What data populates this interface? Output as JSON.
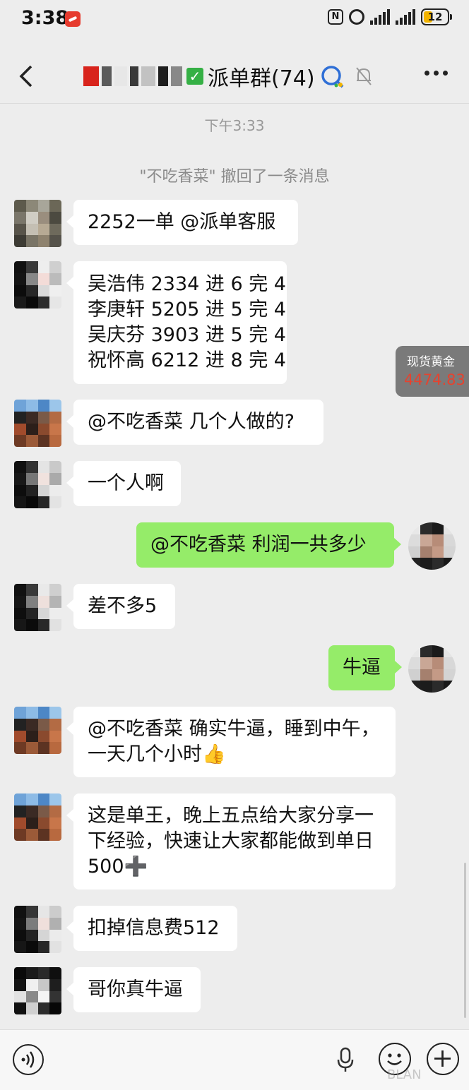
{
  "status_bar": {
    "time": "3:38",
    "battery": "12",
    "nfc_label": "N",
    "icons": [
      "app-badge-icon",
      "nfc-icon",
      "alarm-icon",
      "signal-icon",
      "signal-icon",
      "battery-icon"
    ]
  },
  "header": {
    "title": "派单群(74)",
    "icons": [
      "back-icon",
      "verified-check-icon",
      "pc-online-icon",
      "mute-bell-icon",
      "more-icon"
    ]
  },
  "system": {
    "time": "下午3:33",
    "recall_notice": "\"不吃香菜\" 撤回了一条消息"
  },
  "messages": [
    {
      "side": "left",
      "lines": [
        "2252一单 @派单客服"
      ]
    },
    {
      "side": "left",
      "lines": [
        "吴浩伟 2334 进 6 完 4",
        "李庚轩 5205 进 5 完 4",
        "吴庆芬 3903 进 5 完 4",
        "祝怀高 6212 进 8 完 4"
      ]
    },
    {
      "side": "left",
      "lines": [
        "@不吃香菜  几个人做的?"
      ]
    },
    {
      "side": "left",
      "lines": [
        "一个人啊"
      ]
    },
    {
      "side": "right",
      "lines": [
        "@不吃香菜  利润一共多少"
      ]
    },
    {
      "side": "left",
      "lines": [
        "差不多5"
      ]
    },
    {
      "side": "right",
      "lines": [
        "牛逼"
      ]
    },
    {
      "side": "left",
      "lines": [
        "@不吃香菜  确实牛逼，睡到中午，",
        "一天几个小时👍"
      ]
    },
    {
      "side": "left",
      "lines": [
        "这是单王，晚上五点给大家分享一",
        "下经验，快速让大家都能做到单日",
        "500➕"
      ]
    },
    {
      "side": "left",
      "lines": [
        "扣掉信息费512"
      ]
    },
    {
      "side": "left",
      "lines": [
        "哥你真牛逼"
      ]
    }
  ],
  "ticker": {
    "label": "现货黄金",
    "value": "4474.83"
  },
  "input_bar": {
    "icons": [
      "voice-icon",
      "mic-icon",
      "emoji-icon",
      "plus-icon"
    ]
  },
  "watermark": "BLAN"
}
